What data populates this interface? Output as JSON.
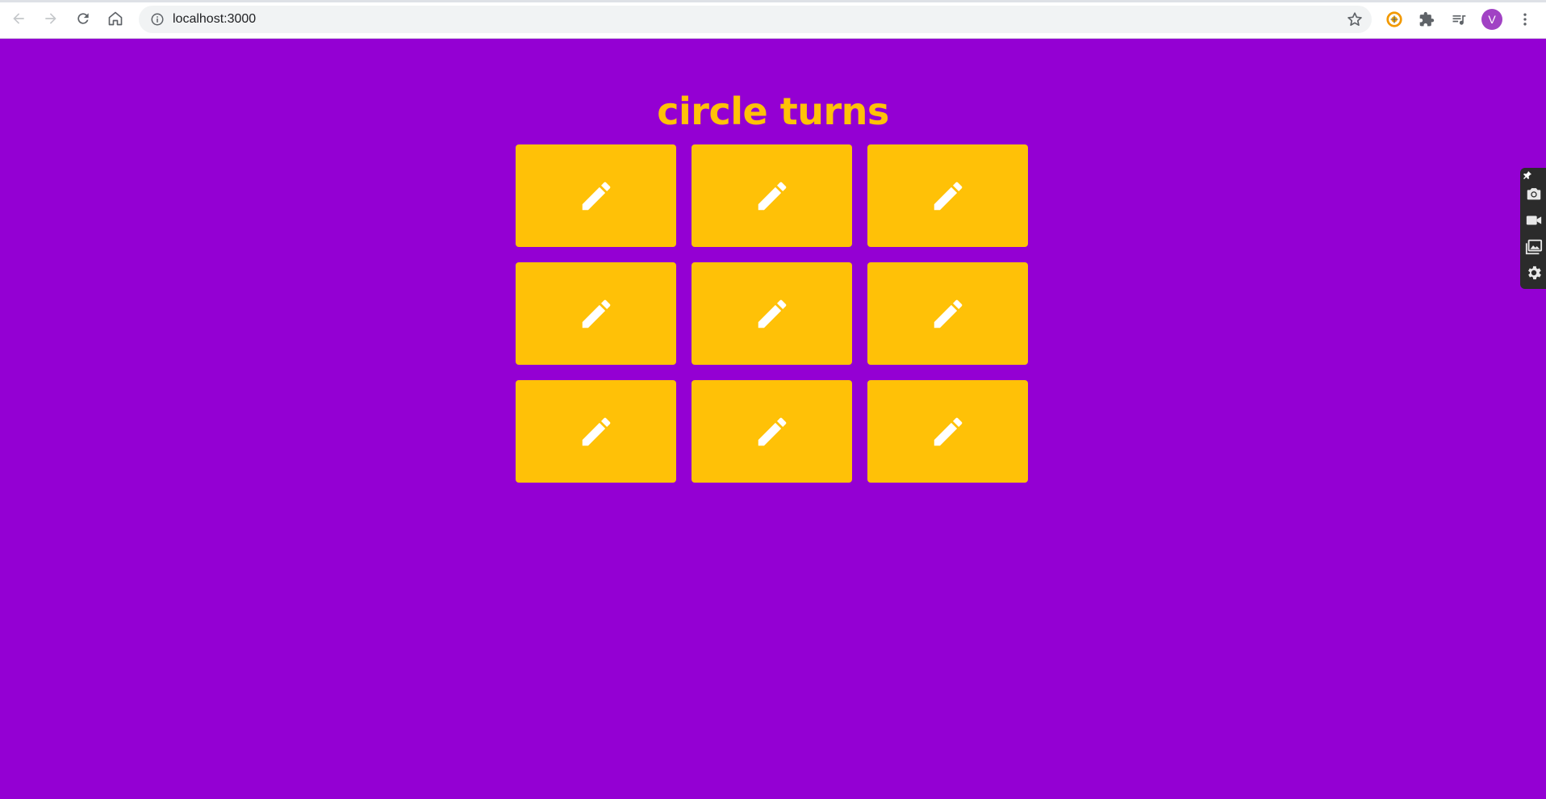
{
  "browser": {
    "url": "localhost:3000",
    "profile_initial": "V",
    "icons": [
      "back-icon",
      "forward-icon",
      "reload-icon",
      "home-icon",
      "info-icon",
      "bookmark-star-icon",
      "extension-orange-icon",
      "puzzle-extensions-icon",
      "media-queue-icon",
      "menu-dots-icon"
    ]
  },
  "page": {
    "title": "circle turns",
    "tiles": [
      {
        "icon": "pencil-icon"
      },
      {
        "icon": "pencil-icon"
      },
      {
        "icon": "pencil-icon"
      },
      {
        "icon": "pencil-icon"
      },
      {
        "icon": "pencil-icon"
      },
      {
        "icon": "pencil-icon"
      },
      {
        "icon": "pencil-icon"
      },
      {
        "icon": "pencil-icon"
      },
      {
        "icon": "pencil-icon"
      }
    ]
  },
  "sidebar": {
    "icons": [
      "pin-icon",
      "camera-icon",
      "video-icon",
      "gallery-icon",
      "settings-gear-icon"
    ]
  },
  "colors": {
    "background": "#9400d3",
    "accent": "#ffc107",
    "icon": "#ffffff"
  }
}
